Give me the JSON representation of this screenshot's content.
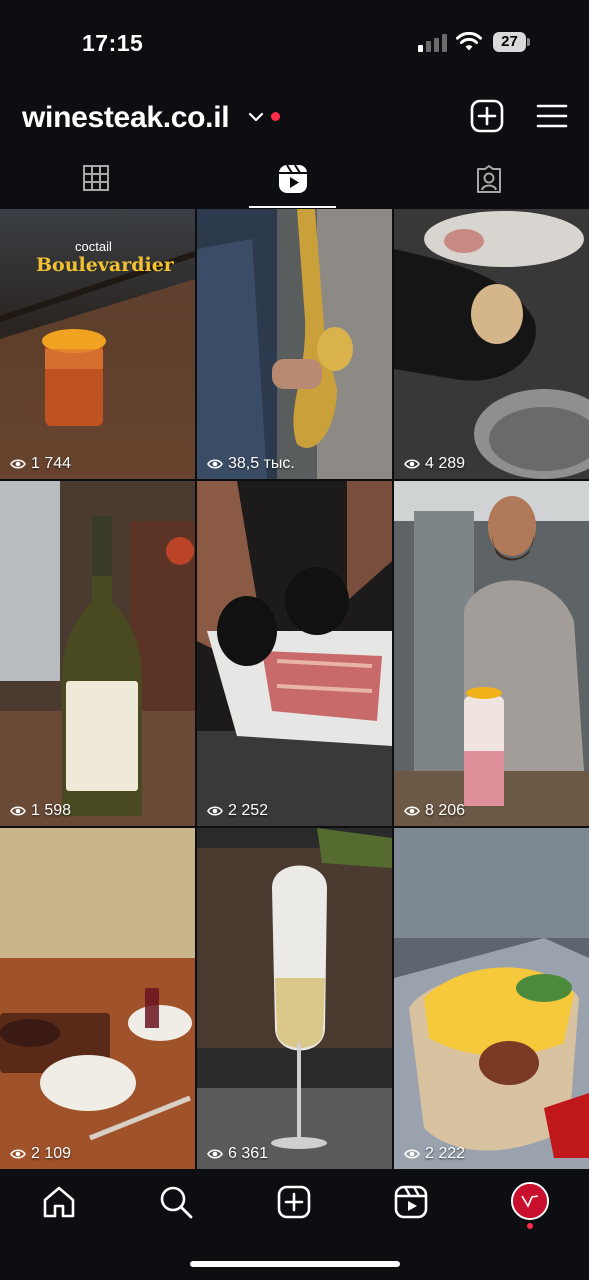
{
  "status_bar": {
    "time": "17:15",
    "battery": "27"
  },
  "header": {
    "username": "winesteak.co.il",
    "notification_color": "#ff2d4a"
  },
  "tabs": [
    {
      "name": "grid",
      "icon": "grid-icon",
      "active": false
    },
    {
      "name": "reels",
      "icon": "reels-icon",
      "active": true
    },
    {
      "name": "tagged",
      "icon": "tagged-icon",
      "active": false
    }
  ],
  "reels": [
    {
      "views": "1 744",
      "overlay_small": "coctail",
      "overlay_big": "Boulevardier"
    },
    {
      "views": "38,5 тыс."
    },
    {
      "views": "4 289"
    },
    {
      "views": "1 598"
    },
    {
      "views": "2 252"
    },
    {
      "views": "8 206"
    },
    {
      "views": "2 109"
    },
    {
      "views": "6 361"
    },
    {
      "views": "2 222"
    }
  ],
  "bottom_nav": [
    {
      "name": "home",
      "icon": "home-icon"
    },
    {
      "name": "search",
      "icon": "search-icon"
    },
    {
      "name": "create",
      "icon": "create-icon"
    },
    {
      "name": "reels",
      "icon": "reels-icon"
    },
    {
      "name": "profile",
      "icon": "avatar"
    }
  ],
  "colors": {
    "background": "#0c0e12",
    "accent": "#ff2d4a"
  }
}
